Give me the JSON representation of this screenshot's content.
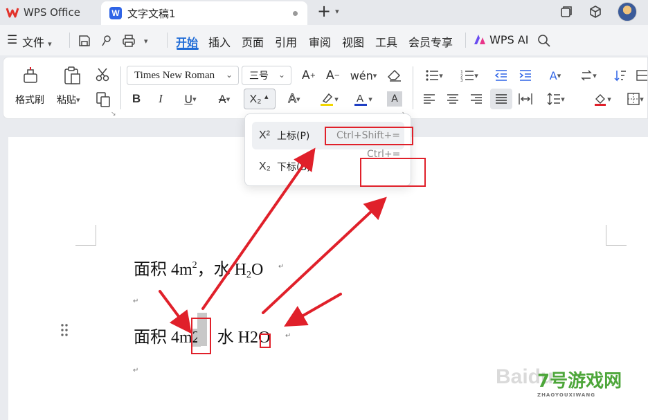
{
  "titlebar": {
    "app_tab_label": "WPS Office",
    "doc_tab_label": "文字文稿1",
    "new_tab_symbol": "+",
    "icons": [
      "window-restore-icon",
      "cube-icon",
      "avatar"
    ]
  },
  "menubar": {
    "file_label": "文件",
    "tabs": [
      "开始",
      "插入",
      "页面",
      "引用",
      "审阅",
      "视图",
      "工具",
      "会员专享"
    ],
    "active_tab": "开始",
    "ai_label": "WPS AI"
  },
  "ribbon": {
    "format_painter_label": "格式刷",
    "paste_label": "粘贴",
    "font_name": "Times New Roman",
    "font_size": "三号",
    "bold": "B",
    "italic": "I",
    "underline": "U",
    "strike": "A",
    "subscript_button": "X₂",
    "highlight_color": "#f2d600",
    "font_color": "#1f3fc4"
  },
  "dropdown": {
    "items": [
      {
        "icon": "X²",
        "label": "上标(P)",
        "shortcut": "Ctrl+Shift+="
      },
      {
        "icon": "X₂",
        "label": "下标(B)",
        "shortcut": "Ctrl+="
      }
    ]
  },
  "document": {
    "line1": {
      "prefix": "面积 4m",
      "sup": "2",
      "middle": "，水 H",
      "sub": "2",
      "suffix": "O"
    },
    "line2": {
      "prefix": "面积 4m",
      "selected": "2",
      "middle": "，水 H",
      "boxed": "2",
      "suffix": "O"
    },
    "para_mark": "↵"
  },
  "annotation_color": "#e0202a",
  "watermark": {
    "baidu": "Baidu",
    "site": "7号游戏网",
    "site_sub": "ZHAOYOUXIWANG"
  }
}
